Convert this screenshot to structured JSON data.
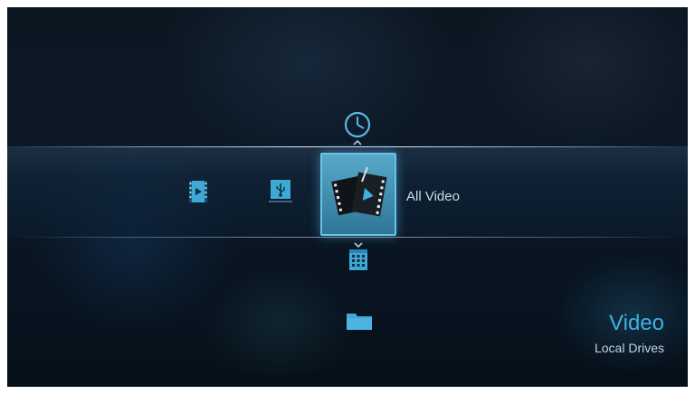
{
  "menu": {
    "selected_item_label": "All Video"
  },
  "section": {
    "title": "Video",
    "subtitle": "Local Drives"
  },
  "icons": {
    "up": "clock-icon",
    "down": "calendar-icon",
    "bottom": "folder-icon",
    "left_1": "video-file-icon",
    "left_2": "usb-icon",
    "selected": "film-clips-icon"
  },
  "colors": {
    "accent": "#3fb1e2",
    "tile": "#4a9fc2"
  }
}
